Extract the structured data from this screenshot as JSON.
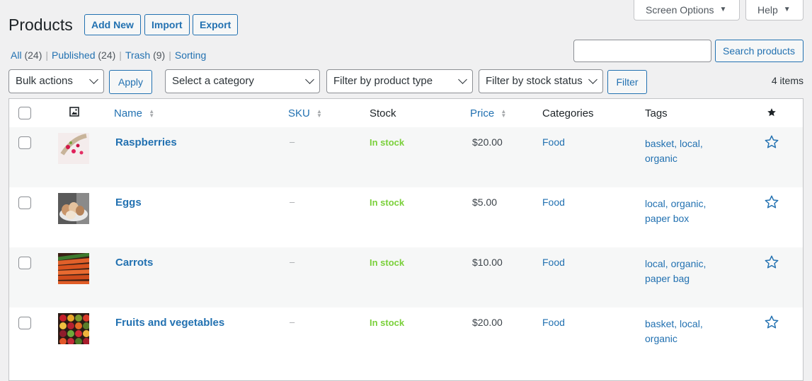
{
  "header": {
    "title": "Products",
    "add_new": "Add New",
    "import": "Import",
    "export": "Export"
  },
  "top_tabs": {
    "screen_options": "Screen Options",
    "help": "Help"
  },
  "views": [
    {
      "label": "All",
      "count": "(24)"
    },
    {
      "label": "Published",
      "count": "(24)"
    },
    {
      "label": "Trash",
      "count": "(9)"
    },
    {
      "label": "Sorting",
      "count": ""
    }
  ],
  "search": {
    "value": "",
    "button": "Search products"
  },
  "filters": {
    "bulk_actions": "Bulk actions",
    "apply": "Apply",
    "category": "Select a category",
    "product_type": "Filter by product type",
    "stock_status": "Filter by stock status",
    "filter": "Filter",
    "items_count": "4 items"
  },
  "columns": {
    "name": "Name",
    "sku": "SKU",
    "stock": "Stock",
    "price": "Price",
    "categories": "Categories",
    "tags": "Tags"
  },
  "rows": [
    {
      "name": "Raspberries",
      "sku": "–",
      "stock": "In stock",
      "price": "$20.00",
      "category": "Food",
      "tags_line1": "basket, local,",
      "tags_line2": "organic"
    },
    {
      "name": "Eggs",
      "sku": "–",
      "stock": "In stock",
      "price": "$5.00",
      "category": "Food",
      "tags_line1": "local, organic,",
      "tags_line2": "paper box"
    },
    {
      "name": "Carrots",
      "sku": "–",
      "stock": "In stock",
      "price": "$10.00",
      "category": "Food",
      "tags_line1": "local, organic,",
      "tags_line2": "paper bag"
    },
    {
      "name": "Fruits and vegetables",
      "sku": "–",
      "stock": "In stock",
      "price": "$20.00",
      "category": "Food",
      "tags_line1": "basket, local,",
      "tags_line2": "organic"
    }
  ],
  "colors": {
    "accent": "#2271b1",
    "in_stock": "#7ad03a",
    "background": "#f0f0f1"
  }
}
